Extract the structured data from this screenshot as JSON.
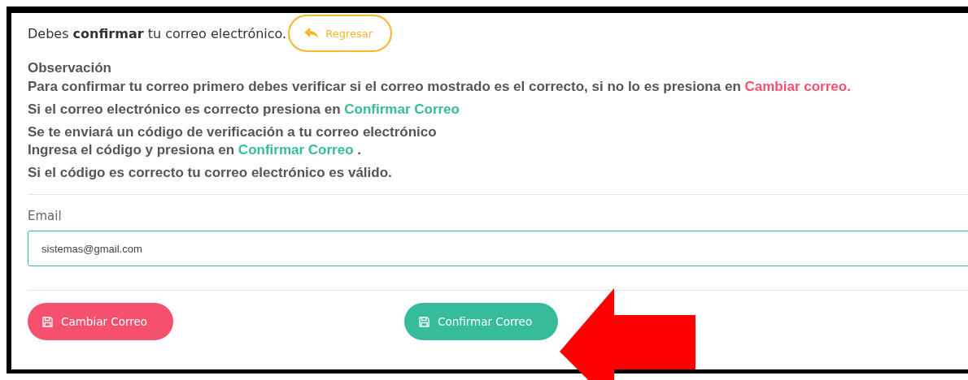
{
  "header": {
    "text": "Debes **confirmar** tu correo electrónico.",
    "back_button": "Regresar"
  },
  "observation": {
    "title": "Observación",
    "lines": [
      [
        {
          "text": "Para confirmar tu correo primero debes verificar si el correo mostrado es el correcto, si no lo es presiona en ",
          "kind": "plain"
        },
        {
          "text": "Cambiar correo.",
          "kind": "danger"
        }
      ],
      [
        {
          "text": "Si el correo electrónico es correcto presiona en ",
          "kind": "plain"
        },
        {
          "text": "Confirmar Correo",
          "kind": "success"
        }
      ],
      [
        {
          "text": "Se te enviará un código de verificación a tu correo electrónico",
          "kind": "plain"
        }
      ],
      [
        {
          "text": "Ingresa el código y presiona en ",
          "kind": "plain"
        },
        {
          "text": "Confirmar Correo",
          "kind": "success"
        },
        {
          "text": " .",
          "kind": "plain"
        }
      ],
      [
        {
          "text": "Si el código es correcto tu correo electrónico es válido.",
          "kind": "plain"
        }
      ]
    ]
  },
  "email": {
    "label": "Email",
    "value": "sistemas@gmail.com"
  },
  "buttons": [
    {
      "label": "Cambiar Correo",
      "kind": "danger"
    },
    {
      "label": "Confirmar Correo",
      "kind": "success"
    }
  ]
}
